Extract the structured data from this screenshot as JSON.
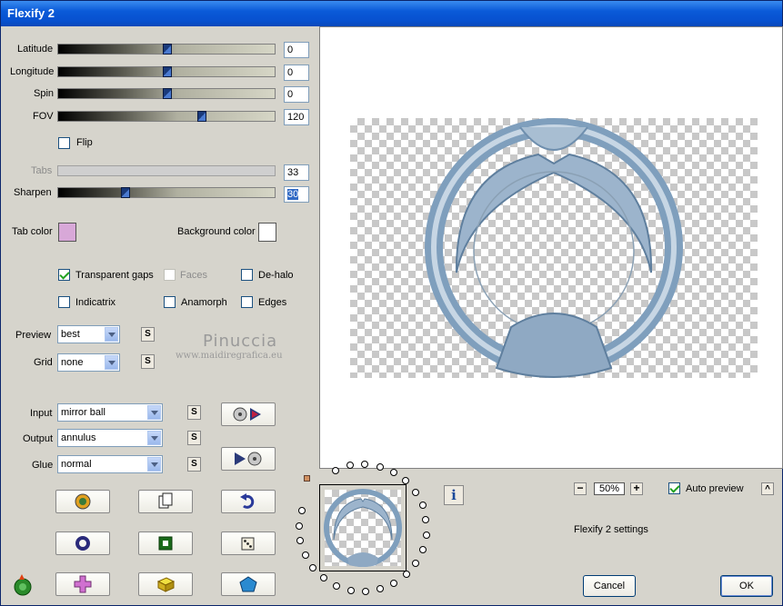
{
  "window": {
    "title": "Flexify 2"
  },
  "sliders": [
    {
      "label": "Latitude",
      "value": "0",
      "fraction": 0.5
    },
    {
      "label": "Longitude",
      "value": "0",
      "fraction": 0.5
    },
    {
      "label": "Spin",
      "value": "0",
      "fraction": 0.5
    },
    {
      "label": "FOV",
      "value": "120",
      "fraction": 0.66
    },
    {
      "label": "Tabs",
      "value": "33",
      "fraction": 0
    },
    {
      "label": "Sharpen",
      "value": "30",
      "fraction": 0.31
    }
  ],
  "flip": {
    "label": "Flip",
    "checked": false
  },
  "colors": {
    "tab_color_label": "Tab color",
    "tab_color": "#d8a8d8",
    "background_color_label": "Background color",
    "background_color": "#ffffff"
  },
  "options": {
    "transparent_gaps": "Transparent gaps",
    "faces": "Faces",
    "de_halo": "De-halo",
    "indicatrix": "Indicatrix",
    "anamorph": "Anamorph",
    "edges": "Edges"
  },
  "preview_select": {
    "label": "Preview",
    "value": "best",
    "s": "S"
  },
  "grid_select": {
    "label": "Grid",
    "value": "none",
    "s": "S"
  },
  "input_select": {
    "label": "Input",
    "value": "mirror ball",
    "s": "S"
  },
  "output_select": {
    "label": "Output",
    "value": "annulus",
    "s": "S"
  },
  "glue_select": {
    "label": "Glue",
    "value": "normal",
    "s": "S"
  },
  "watermark": {
    "name": "Pinuccia",
    "site": "www.maidiregrafica.eu"
  },
  "zoom": {
    "value": "50%",
    "minus": "−",
    "plus": "+"
  },
  "auto_preview": {
    "label": "Auto preview",
    "checked": true,
    "caret": "^"
  },
  "settings_label": "Flexify 2 settings",
  "buttons": {
    "cancel": "Cancel",
    "ok": "OK"
  },
  "info_icon": "i"
}
